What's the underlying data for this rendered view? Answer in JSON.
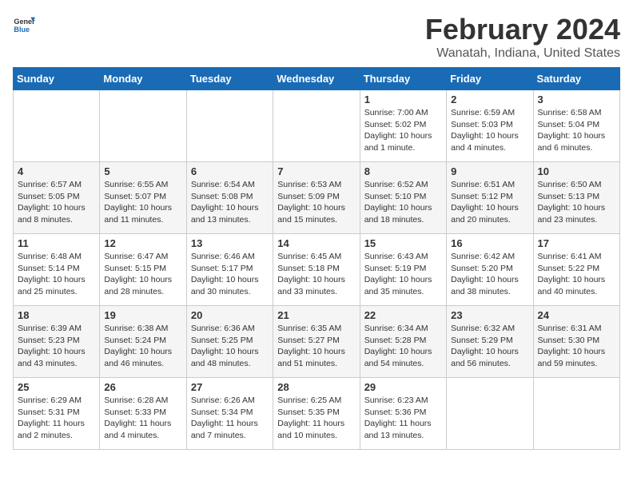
{
  "logo": {
    "general": "General",
    "blue": "Blue"
  },
  "title": "February 2024",
  "subtitle": "Wanatah, Indiana, United States",
  "headers": [
    "Sunday",
    "Monday",
    "Tuesday",
    "Wednesday",
    "Thursday",
    "Friday",
    "Saturday"
  ],
  "weeks": [
    [
      {
        "day": "",
        "info": ""
      },
      {
        "day": "",
        "info": ""
      },
      {
        "day": "",
        "info": ""
      },
      {
        "day": "",
        "info": ""
      },
      {
        "day": "1",
        "info": "Sunrise: 7:00 AM\nSunset: 5:02 PM\nDaylight: 10 hours\nand 1 minute."
      },
      {
        "day": "2",
        "info": "Sunrise: 6:59 AM\nSunset: 5:03 PM\nDaylight: 10 hours\nand 4 minutes."
      },
      {
        "day": "3",
        "info": "Sunrise: 6:58 AM\nSunset: 5:04 PM\nDaylight: 10 hours\nand 6 minutes."
      }
    ],
    [
      {
        "day": "4",
        "info": "Sunrise: 6:57 AM\nSunset: 5:05 PM\nDaylight: 10 hours\nand 8 minutes."
      },
      {
        "day": "5",
        "info": "Sunrise: 6:55 AM\nSunset: 5:07 PM\nDaylight: 10 hours\nand 11 minutes."
      },
      {
        "day": "6",
        "info": "Sunrise: 6:54 AM\nSunset: 5:08 PM\nDaylight: 10 hours\nand 13 minutes."
      },
      {
        "day": "7",
        "info": "Sunrise: 6:53 AM\nSunset: 5:09 PM\nDaylight: 10 hours\nand 15 minutes."
      },
      {
        "day": "8",
        "info": "Sunrise: 6:52 AM\nSunset: 5:10 PM\nDaylight: 10 hours\nand 18 minutes."
      },
      {
        "day": "9",
        "info": "Sunrise: 6:51 AM\nSunset: 5:12 PM\nDaylight: 10 hours\nand 20 minutes."
      },
      {
        "day": "10",
        "info": "Sunrise: 6:50 AM\nSunset: 5:13 PM\nDaylight: 10 hours\nand 23 minutes."
      }
    ],
    [
      {
        "day": "11",
        "info": "Sunrise: 6:48 AM\nSunset: 5:14 PM\nDaylight: 10 hours\nand 25 minutes."
      },
      {
        "day": "12",
        "info": "Sunrise: 6:47 AM\nSunset: 5:15 PM\nDaylight: 10 hours\nand 28 minutes."
      },
      {
        "day": "13",
        "info": "Sunrise: 6:46 AM\nSunset: 5:17 PM\nDaylight: 10 hours\nand 30 minutes."
      },
      {
        "day": "14",
        "info": "Sunrise: 6:45 AM\nSunset: 5:18 PM\nDaylight: 10 hours\nand 33 minutes."
      },
      {
        "day": "15",
        "info": "Sunrise: 6:43 AM\nSunset: 5:19 PM\nDaylight: 10 hours\nand 35 minutes."
      },
      {
        "day": "16",
        "info": "Sunrise: 6:42 AM\nSunset: 5:20 PM\nDaylight: 10 hours\nand 38 minutes."
      },
      {
        "day": "17",
        "info": "Sunrise: 6:41 AM\nSunset: 5:22 PM\nDaylight: 10 hours\nand 40 minutes."
      }
    ],
    [
      {
        "day": "18",
        "info": "Sunrise: 6:39 AM\nSunset: 5:23 PM\nDaylight: 10 hours\nand 43 minutes."
      },
      {
        "day": "19",
        "info": "Sunrise: 6:38 AM\nSunset: 5:24 PM\nDaylight: 10 hours\nand 46 minutes."
      },
      {
        "day": "20",
        "info": "Sunrise: 6:36 AM\nSunset: 5:25 PM\nDaylight: 10 hours\nand 48 minutes."
      },
      {
        "day": "21",
        "info": "Sunrise: 6:35 AM\nSunset: 5:27 PM\nDaylight: 10 hours\nand 51 minutes."
      },
      {
        "day": "22",
        "info": "Sunrise: 6:34 AM\nSunset: 5:28 PM\nDaylight: 10 hours\nand 54 minutes."
      },
      {
        "day": "23",
        "info": "Sunrise: 6:32 AM\nSunset: 5:29 PM\nDaylight: 10 hours\nand 56 minutes."
      },
      {
        "day": "24",
        "info": "Sunrise: 6:31 AM\nSunset: 5:30 PM\nDaylight: 10 hours\nand 59 minutes."
      }
    ],
    [
      {
        "day": "25",
        "info": "Sunrise: 6:29 AM\nSunset: 5:31 PM\nDaylight: 11 hours\nand 2 minutes."
      },
      {
        "day": "26",
        "info": "Sunrise: 6:28 AM\nSunset: 5:33 PM\nDaylight: 11 hours\nand 4 minutes."
      },
      {
        "day": "27",
        "info": "Sunrise: 6:26 AM\nSunset: 5:34 PM\nDaylight: 11 hours\nand 7 minutes."
      },
      {
        "day": "28",
        "info": "Sunrise: 6:25 AM\nSunset: 5:35 PM\nDaylight: 11 hours\nand 10 minutes."
      },
      {
        "day": "29",
        "info": "Sunrise: 6:23 AM\nSunset: 5:36 PM\nDaylight: 11 hours\nand 13 minutes."
      },
      {
        "day": "",
        "info": ""
      },
      {
        "day": "",
        "info": ""
      }
    ]
  ]
}
